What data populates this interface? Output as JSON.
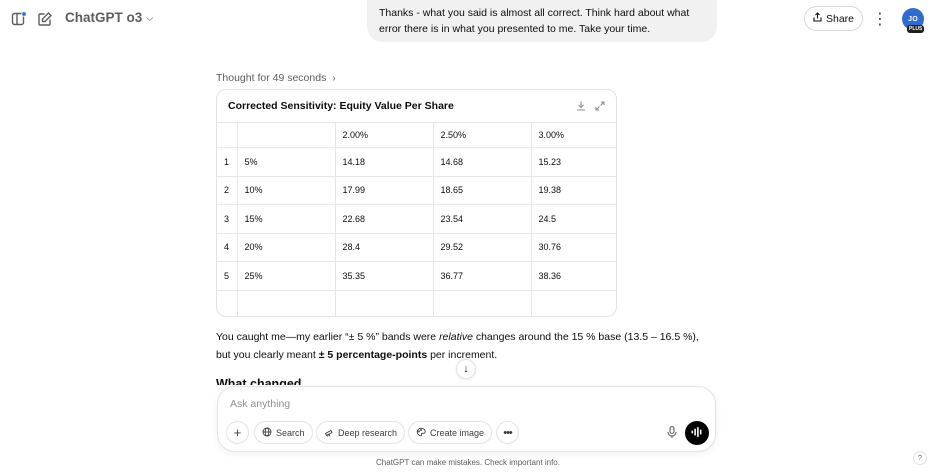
{
  "header": {
    "model_name": "ChatGPT o3",
    "share_label": "Share",
    "avatar_initials": "JO",
    "plan_badge": "PLUS"
  },
  "conversation": {
    "user_message_line1": "Thanks - what you said is almost all correct. Think hard about what",
    "user_message_line2": "error there is in what you presented to me. Take your time.",
    "thought_label": "Thought for 49 seconds",
    "table": {
      "title": "Corrected Sensitivity: Equity Value Per Share",
      "columns": [
        "",
        "",
        "2.00%",
        "2.50%",
        "3.00%"
      ],
      "rows": [
        [
          "1",
          "5%",
          "14.18",
          "14.68",
          "15.23"
        ],
        [
          "2",
          "10%",
          "17.99",
          "18.65",
          "19.38"
        ],
        [
          "3",
          "15%",
          "22.68",
          "23.54",
          "24.5"
        ],
        [
          "4",
          "20%",
          "28.4",
          "29.52",
          "30.76"
        ],
        [
          "5",
          "25%",
          "35.35",
          "36.77",
          "38.36"
        ]
      ]
    },
    "reply": {
      "l1_a": "You caught me—my earlier “± 5 %” bands were ",
      "l1_italic": "relative",
      "l1_b": " changes around the 15 % base (13.5 – 16.5 %),",
      "l2_a": "but you clearly meant ",
      "l2_bold": "± 5 percentage-points",
      "l2_b": " per increment."
    },
    "section_heading": "What changed"
  },
  "composer": {
    "placeholder": "Ask anything",
    "search_label": "Search",
    "deep_research_label": "Deep research",
    "create_image_label": "Create image"
  },
  "footer": {
    "disclaimer": "ChatGPT can make mistakes. Check important info.",
    "help_label": "?"
  },
  "colors": {
    "accent_avatar": "#2f6bd1",
    "user_bubble_bg": "#f1f1f1",
    "new_chat_dot": "#2f6bd1"
  }
}
